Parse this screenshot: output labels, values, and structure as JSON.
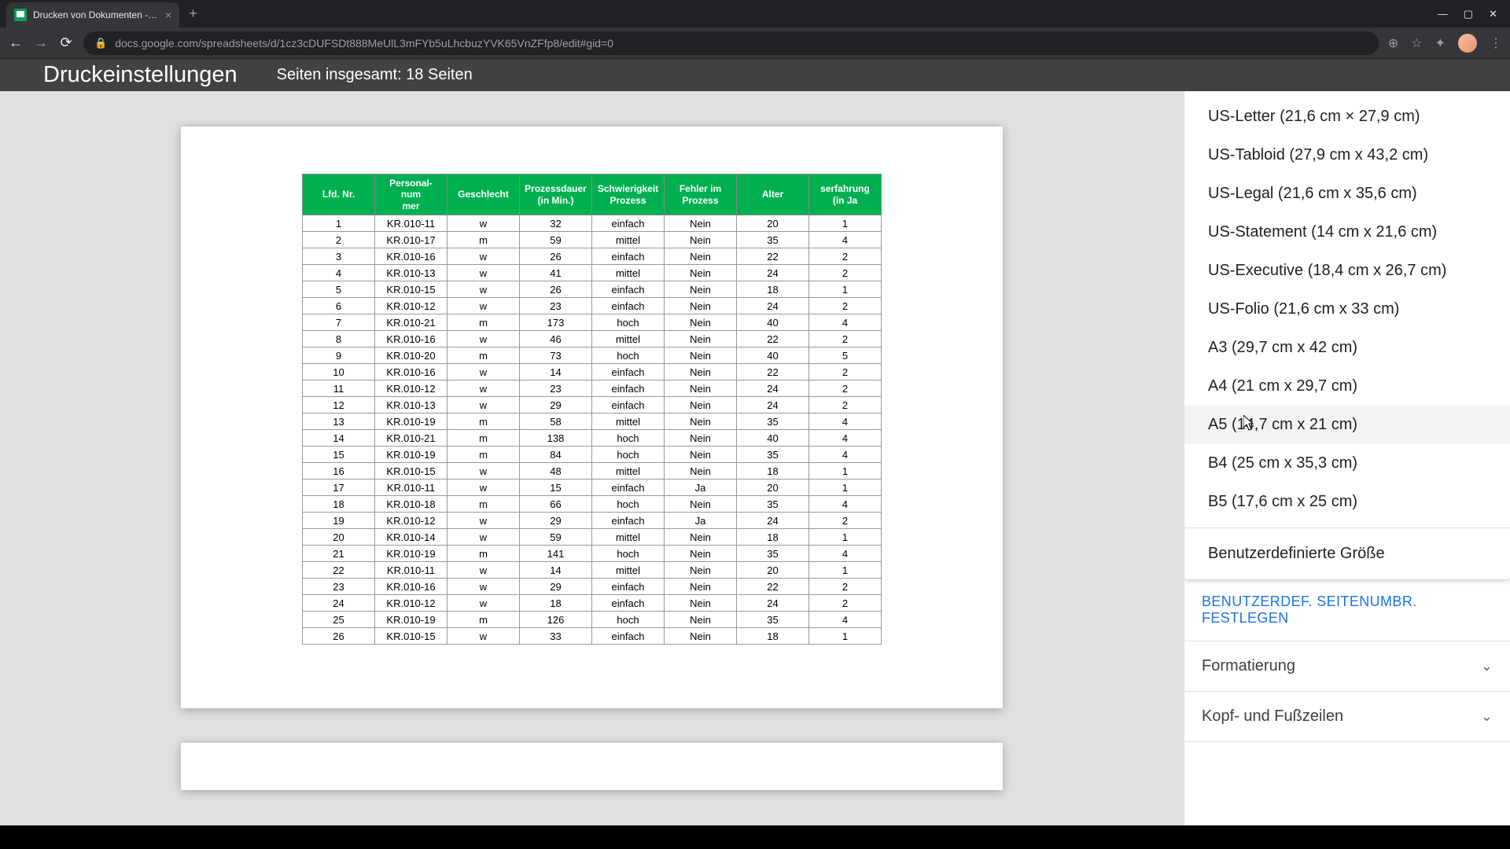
{
  "browser": {
    "tab_title": "Drucken von Dokumenten - Goo...",
    "url": "docs.google.com/spreadsheets/d/1cz3cDUFSDt888MeUlL3mFYb5uLhcbuzYVK65VnZFfp8/edit#gid=0"
  },
  "header": {
    "title": "Druckeinstellungen",
    "pages_label": "Seiten insgesamt: 18 Seiten"
  },
  "table": {
    "headers": [
      "Lfd. Nr.",
      "Personal-num\nmer",
      "Geschlecht",
      "Prozessdauer\n(in Min.)",
      "Schwierigkeit\nProzess",
      "Fehler im\nProzess",
      "Alter",
      "serfahrung (in Ja"
    ],
    "rows": [
      [
        "1",
        "KR.010-11",
        "w",
        "32",
        "einfach",
        "Nein",
        "20",
        "1"
      ],
      [
        "2",
        "KR.010-17",
        "m",
        "59",
        "mittel",
        "Nein",
        "35",
        "4"
      ],
      [
        "3",
        "KR.010-16",
        "w",
        "26",
        "einfach",
        "Nein",
        "22",
        "2"
      ],
      [
        "4",
        "KR.010-13",
        "w",
        "41",
        "mittel",
        "Nein",
        "24",
        "2"
      ],
      [
        "5",
        "KR.010-15",
        "w",
        "26",
        "einfach",
        "Nein",
        "18",
        "1"
      ],
      [
        "6",
        "KR.010-12",
        "w",
        "23",
        "einfach",
        "Nein",
        "24",
        "2"
      ],
      [
        "7",
        "KR.010-21",
        "m",
        "173",
        "hoch",
        "Nein",
        "40",
        "4"
      ],
      [
        "8",
        "KR.010-16",
        "w",
        "46",
        "mittel",
        "Nein",
        "22",
        "2"
      ],
      [
        "9",
        "KR.010-20",
        "m",
        "73",
        "hoch",
        "Nein",
        "40",
        "5"
      ],
      [
        "10",
        "KR.010-16",
        "w",
        "14",
        "einfach",
        "Nein",
        "22",
        "2"
      ],
      [
        "11",
        "KR.010-12",
        "w",
        "23",
        "einfach",
        "Nein",
        "24",
        "2"
      ],
      [
        "12",
        "KR.010-13",
        "w",
        "29",
        "einfach",
        "Nein",
        "24",
        "2"
      ],
      [
        "13",
        "KR.010-19",
        "m",
        "58",
        "mittel",
        "Nein",
        "35",
        "4"
      ],
      [
        "14",
        "KR.010-21",
        "m",
        "138",
        "hoch",
        "Nein",
        "40",
        "4"
      ],
      [
        "15",
        "KR.010-19",
        "m",
        "84",
        "hoch",
        "Nein",
        "35",
        "4"
      ],
      [
        "16",
        "KR.010-15",
        "w",
        "48",
        "mittel",
        "Nein",
        "18",
        "1"
      ],
      [
        "17",
        "KR.010-11",
        "w",
        "15",
        "einfach",
        "Ja",
        "20",
        "1"
      ],
      [
        "18",
        "KR.010-18",
        "m",
        "66",
        "hoch",
        "Nein",
        "35",
        "4"
      ],
      [
        "19",
        "KR.010-12",
        "w",
        "29",
        "einfach",
        "Ja",
        "24",
        "2"
      ],
      [
        "20",
        "KR.010-14",
        "w",
        "59",
        "mittel",
        "Nein",
        "18",
        "1"
      ],
      [
        "21",
        "KR.010-19",
        "m",
        "141",
        "hoch",
        "Nein",
        "35",
        "4"
      ],
      [
        "22",
        "KR.010-11",
        "w",
        "14",
        "mittel",
        "Nein",
        "20",
        "1"
      ],
      [
        "23",
        "KR.010-16",
        "w",
        "29",
        "einfach",
        "Nein",
        "22",
        "2"
      ],
      [
        "24",
        "KR.010-12",
        "w",
        "18",
        "einfach",
        "Nein",
        "24",
        "2"
      ],
      [
        "25",
        "KR.010-19",
        "m",
        "126",
        "hoch",
        "Nein",
        "35",
        "4"
      ],
      [
        "26",
        "KR.010-15",
        "w",
        "33",
        "einfach",
        "Nein",
        "18",
        "1"
      ]
    ]
  },
  "paper_sizes": [
    "US-Letter (21,6 cm × 27,9 cm)",
    "US-Tabloid (27,9 cm x 43,2 cm)",
    "US-Legal (21,6 cm x 35,6 cm)",
    "US-Statement (14 cm x 21,6 cm)",
    "US-Executive (18,4 cm x 26,7 cm)",
    "US-Folio (21,6 cm x 33 cm)",
    "A3 (29,7 cm x 42 cm)",
    "A4 (21 cm x 29,7 cm)",
    "A5 (14,7 cm x 21 cm)",
    "B4 (25 cm x 35,3 cm)",
    "B5 (17,6 cm x 25 cm)"
  ],
  "custom_size_label": "Benutzerdefinierte Größe",
  "custom_pagebreak_label": "BENUTZERDEF. SEITENUMBR. FESTLEGEN",
  "sections": {
    "formatting": "Formatierung",
    "headers_footers": "Kopf- und Fußzeilen"
  },
  "colors": {
    "header_bg": "#424242",
    "table_header_bg": "#00b050",
    "link_color": "#1a73e8",
    "preview_bg": "#e0e0e0"
  }
}
